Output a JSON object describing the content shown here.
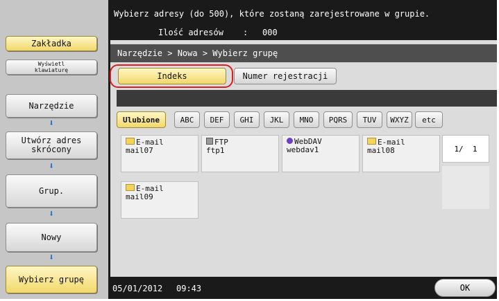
{
  "header": {
    "instruction": "Wybierz adresy (do 500), które zostaną zarejestrowane w grupie.",
    "count_label": "Ilość adresów",
    "count_sep": ":",
    "count_value": "000"
  },
  "sidebar": {
    "bookmark_label": "Zakładka",
    "show_keyboard_label": "Wyświetl klawiaturę",
    "steps": [
      {
        "label": "Narzędzie"
      },
      {
        "label": "Utwórz adres skrócony"
      },
      {
        "label": "Grup."
      },
      {
        "label": "Nowy"
      },
      {
        "label": "Wybierz grupę"
      }
    ],
    "arrow_glyph": "⬇"
  },
  "breadcrumb": "Narzędzie > Nowa > Wybierz grupę",
  "tabs": [
    {
      "label": "Indeks",
      "active": true
    },
    {
      "label": "Numer rejestracji",
      "active": false
    }
  ],
  "filters": [
    "Ulubione",
    "ABC",
    "DEF",
    "GHI",
    "JKL",
    "MNO",
    "PQRS",
    "TUV",
    "WXYZ",
    "etc"
  ],
  "entries": [
    {
      "type": "E-mail",
      "name": "mail07",
      "icon": "email-icon"
    },
    {
      "type": "FTP",
      "name": "ftp1",
      "icon": "ftp-icon"
    },
    {
      "type": "WebDAV",
      "name": "webdav1",
      "icon": "webdav-icon"
    },
    {
      "type": "E-mail",
      "name": "mail08",
      "icon": "email-icon"
    },
    {
      "type": "E-mail",
      "name": "mail09",
      "icon": "email-icon"
    }
  ],
  "pager": "1/  1",
  "footer": {
    "date": "05/01/2012",
    "time": "09:43",
    "ok_label": "OK"
  },
  "colors": {
    "accent_yellow": "#f1d86b",
    "panel_dark": "#1a1a1a",
    "focus_red": "#d91e1e",
    "arrow_blue": "#1f6fd6"
  }
}
